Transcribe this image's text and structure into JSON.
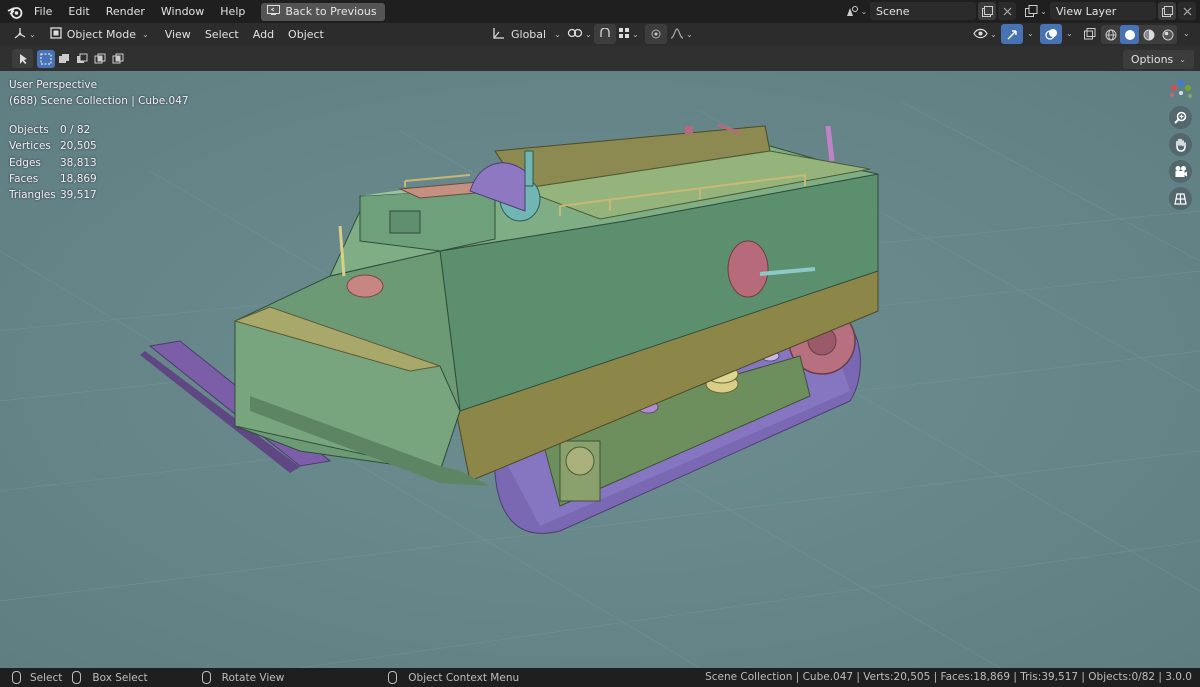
{
  "topbar": {
    "menus": [
      "File",
      "Edit",
      "Render",
      "Window",
      "Help"
    ],
    "back_label": "Back to Previous",
    "scene": "Scene",
    "view_layer": "View Layer"
  },
  "header": {
    "mode": "Object Mode",
    "menus": [
      "View",
      "Select",
      "Add",
      "Object"
    ],
    "orientation": "Global"
  },
  "toolbar": {
    "options_label": "Options"
  },
  "viewport": {
    "perspective": "User Perspective",
    "collection": "(688) Scene Collection | Cube.047",
    "stats": [
      {
        "label": "Objects",
        "value": "0 / 82"
      },
      {
        "label": "Vertices",
        "value": "20,505"
      },
      {
        "label": "Edges",
        "value": "38,813"
      },
      {
        "label": "Faces",
        "value": "18,869"
      },
      {
        "label": "Triangles",
        "value": "39,517"
      }
    ],
    "background_color": "#67868a"
  },
  "statusbar": {
    "select": "Select",
    "box_select": "Box Select",
    "rotate": "Rotate View",
    "context_menu": "Object Context Menu",
    "info": "Scene Collection | Cube.047 | Verts:20,505 | Faces:18,869 | Tris:39,517 | Objects:0/82 | 3.0.0"
  },
  "colors": {
    "accent": "#4772b3",
    "hull": "#6f9e78",
    "track": "#7c6aa8"
  }
}
